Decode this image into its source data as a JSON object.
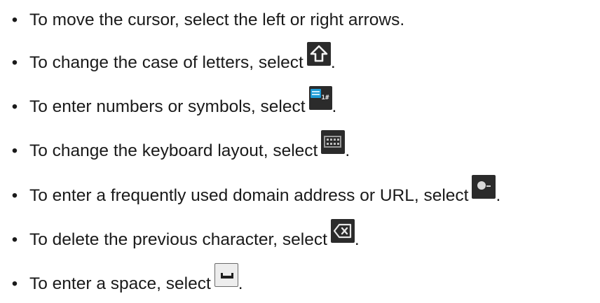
{
  "bullet_char": "•",
  "items": [
    {
      "text": "To move the cursor, select the left or right arrows.",
      "icon": null
    },
    {
      "text": "To change the case of letters, select",
      "icon": "shift-key-icon",
      "suffix": "."
    },
    {
      "text": "To enter numbers or symbols, select",
      "icon": "symbols-key-icon",
      "icon_label": "1#",
      "suffix": "."
    },
    {
      "text": "To change the keyboard layout, select",
      "icon": "keyboard-layout-key-icon",
      "suffix": "."
    },
    {
      "text": "To enter a frequently used domain address or URL, select",
      "icon": "domain-key-icon",
      "suffix": "."
    },
    {
      "text": "To delete the previous character, select",
      "icon": "backspace-key-icon",
      "suffix": "."
    },
    {
      "text": "To enter a space, select",
      "icon": "space-key-icon",
      "suffix": "."
    }
  ],
  "colors": {
    "text": "#1a1a1a",
    "key_bg": "#2b2b2b",
    "symbols_blue": "#1e9bd6"
  }
}
